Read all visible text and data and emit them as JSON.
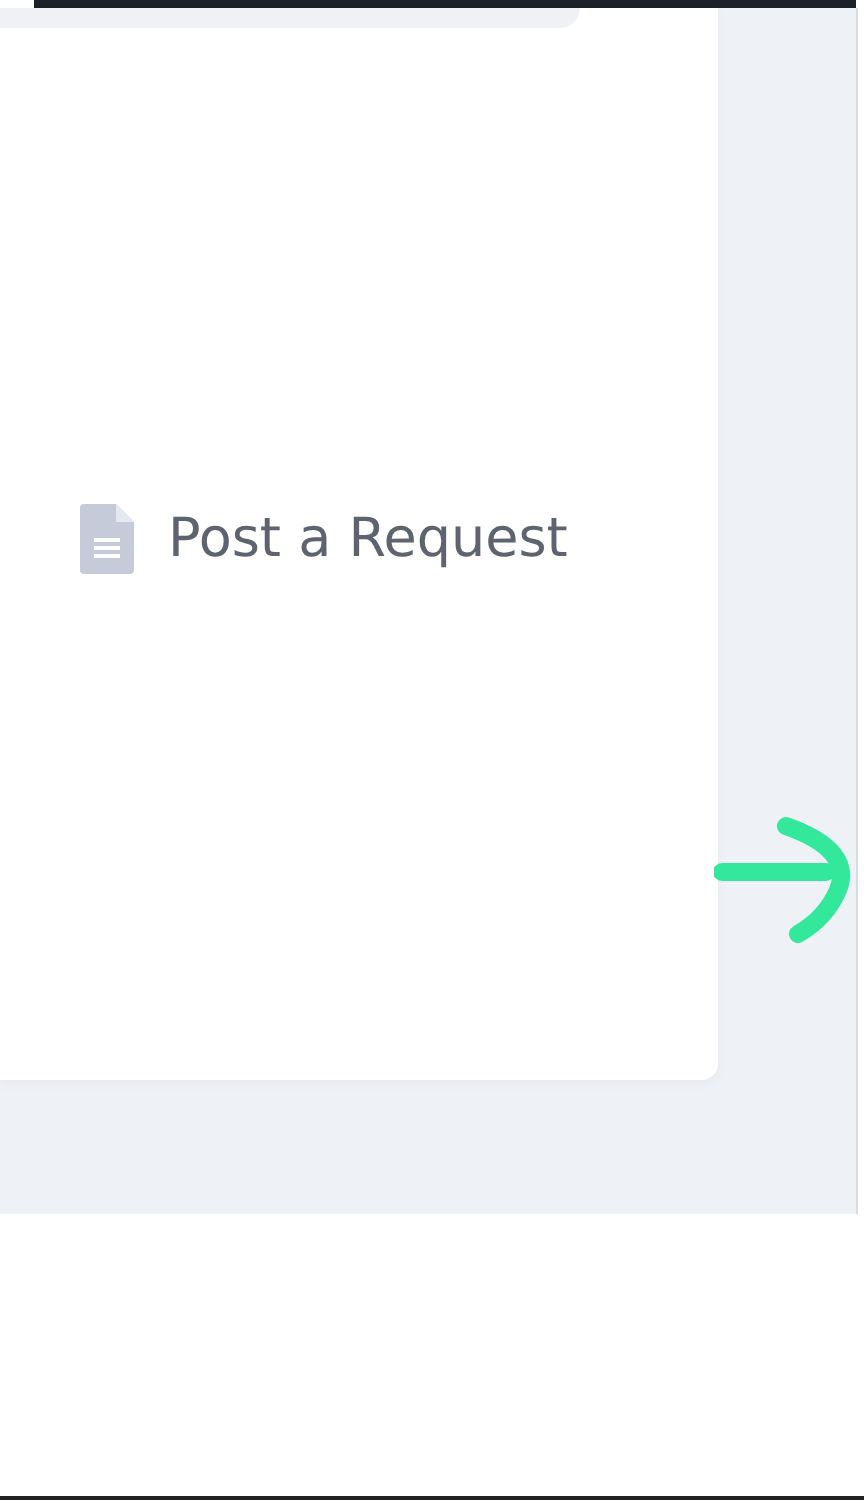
{
  "card": {
    "link": {
      "label": "Post a Request"
    }
  }
}
